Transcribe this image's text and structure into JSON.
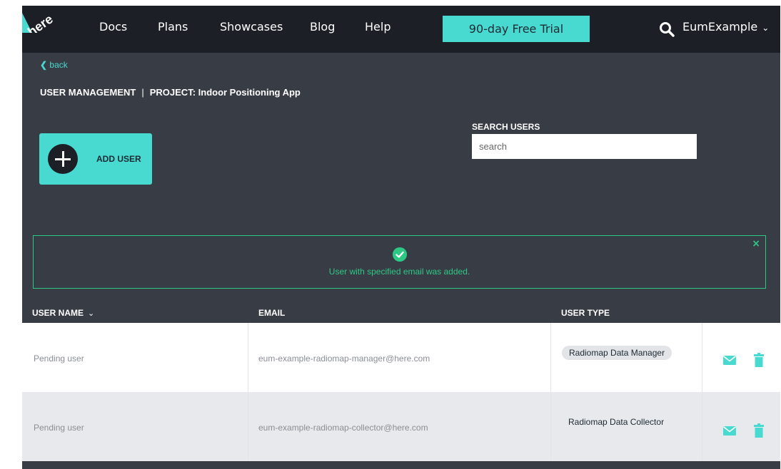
{
  "nav": {
    "links": [
      "Docs",
      "Plans",
      "Showcases",
      "Blog",
      "Help"
    ],
    "trial_button": "90-day Free Trial",
    "account_name": "EumExample",
    "logo_text": "here"
  },
  "page": {
    "back_label": "back",
    "section": "USER MANAGEMENT",
    "separator": "|",
    "project": "PROJECT: Indoor Positioning App"
  },
  "actions": {
    "add_user_label": "ADD USER"
  },
  "search": {
    "label": "SEARCH USERS",
    "placeholder": "search",
    "value": ""
  },
  "alert": {
    "message": "User with specified email was added.",
    "close_symbol": "×"
  },
  "table": {
    "headers": {
      "user_name": "USER NAME",
      "email": "EMAIL",
      "user_type": "USER TYPE"
    },
    "rows": [
      {
        "name": "Pending user",
        "email": "eum-example-radiomap-manager@here.com",
        "user_type": "Radiomap Data Manager"
      },
      {
        "name": "Pending user",
        "email": "eum-example-radiomap-collector@here.com",
        "user_type": "Radiomap Data Collector"
      }
    ]
  },
  "colors": {
    "accent": "#48dad0",
    "success": "#2ec885",
    "nav_background": "#1c1f26",
    "page_background": "#383c45"
  }
}
